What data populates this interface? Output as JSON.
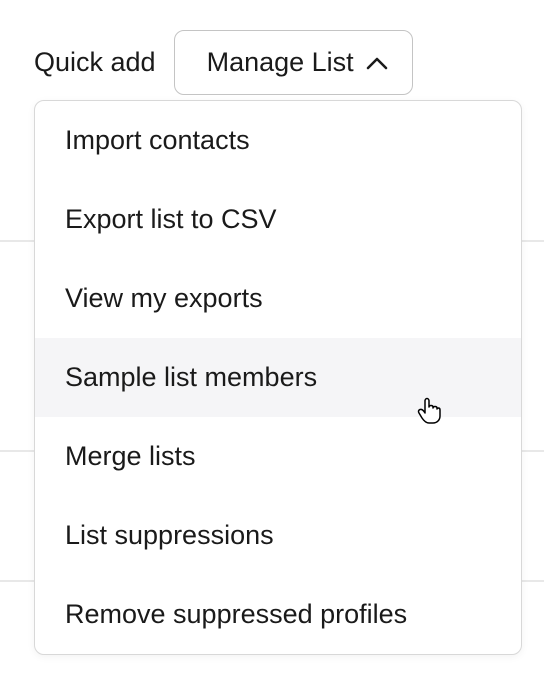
{
  "header": {
    "quick_add_label": "Quick add",
    "manage_list_label": "Manage List"
  },
  "menu": {
    "items": [
      {
        "label": "Import contacts"
      },
      {
        "label": "Export list to CSV"
      },
      {
        "label": "View my exports"
      },
      {
        "label": "Sample list members"
      },
      {
        "label": "Merge lists"
      },
      {
        "label": "List suppressions"
      },
      {
        "label": "Remove suppressed profiles"
      }
    ],
    "hovered_index": 3
  }
}
